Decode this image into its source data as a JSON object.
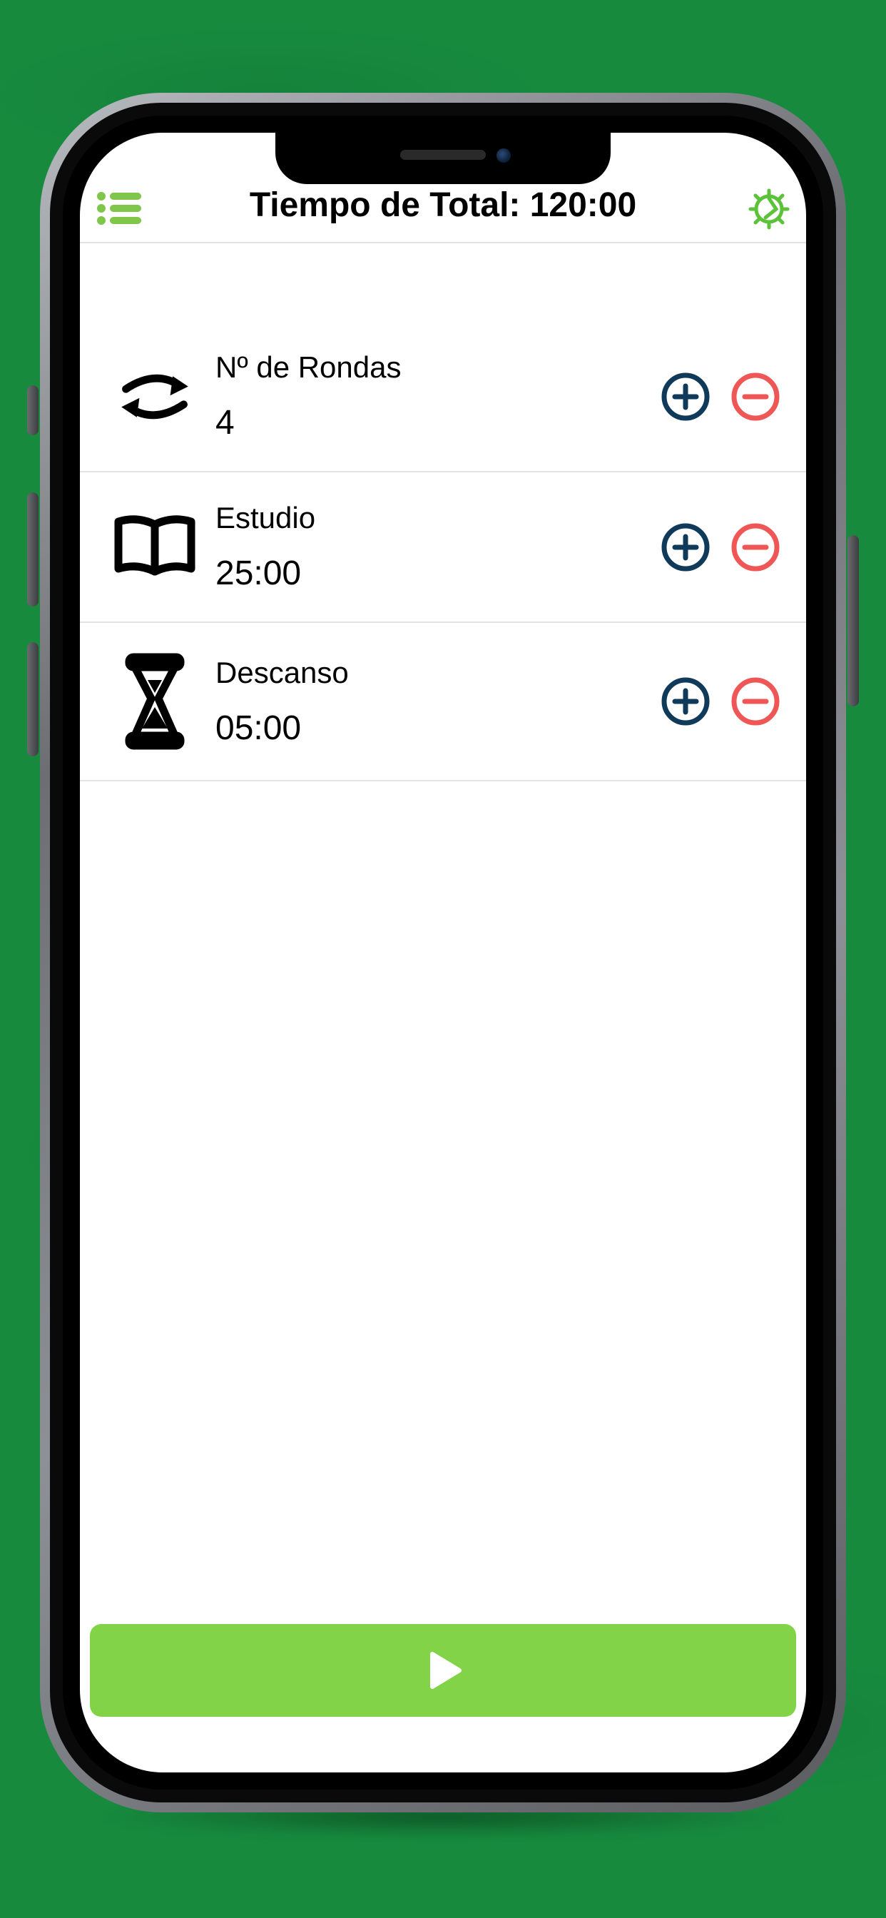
{
  "colors": {
    "accent": "#82d348",
    "menu": "#7fc64a",
    "gear": "#5bc23a",
    "plus": "#0f3a5a",
    "minus": "#ef5757",
    "divider": "#e3e3e3"
  },
  "header": {
    "title": "Tiempo de Total: 120:00"
  },
  "rows": [
    {
      "icon": "repeat",
      "label": "Nº de Rondas",
      "value": "4"
    },
    {
      "icon": "book",
      "label": "Estudio",
      "value": "25:00"
    },
    {
      "icon": "hourglass",
      "label": "Descanso",
      "value": "05:00"
    }
  ]
}
